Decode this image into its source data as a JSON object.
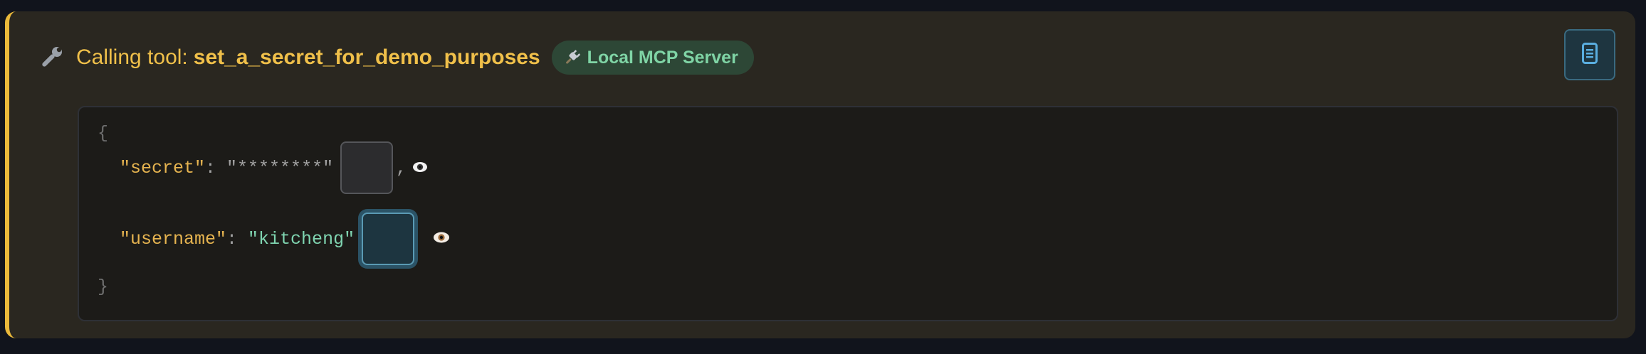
{
  "tool_call": {
    "calling_label": "Calling tool:",
    "tool_name": "set_a_secret_for_demo_purposes",
    "server_badge": "Local MCP Server"
  },
  "code": {
    "open_brace": "{",
    "close_brace": "}",
    "secret_key": "\"secret\"",
    "secret_value_masked": "\"********\"",
    "username_key": "\"username\"",
    "username_value": "\"kitcheng\"",
    "colon": ": ",
    "comma": ","
  },
  "colors": {
    "accent": "#eab93b",
    "badge_bg": "#2d4736",
    "badge_text": "#7fd4a5",
    "key": "#e6b450",
    "string": "#7fd4b0"
  },
  "icons": [
    "wrench-icon",
    "plug-icon",
    "document-icon",
    "eye-icon"
  ]
}
